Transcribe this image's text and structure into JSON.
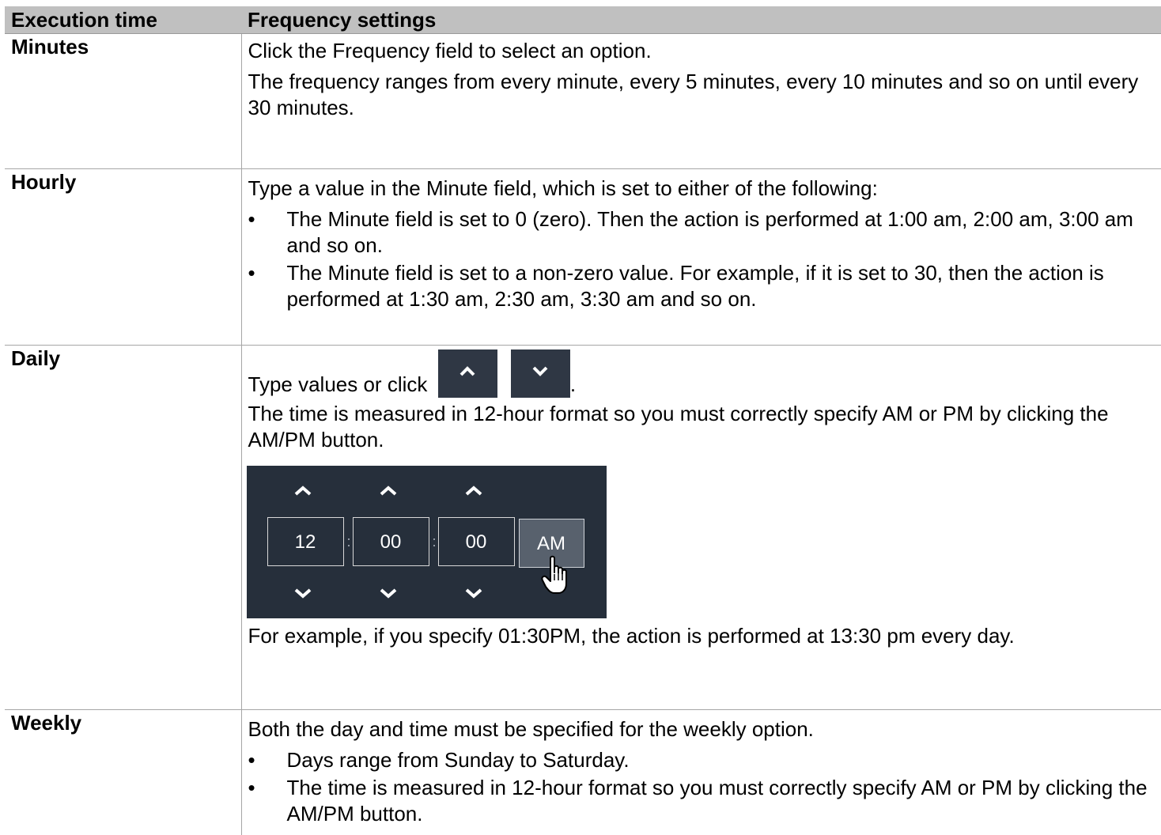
{
  "table": {
    "headers": [
      "Execution time",
      "Frequency settings"
    ],
    "rows": [
      {
        "time": "Minutes",
        "paragraphs": [
          "Click the Frequency field to select an option.",
          "The frequency ranges from every minute, every 5 minutes, every 10 minutes and so on until every 30 minutes."
        ]
      },
      {
        "time": "Hourly",
        "intro": "Type a value in the Minute field, which is set to either of the following:",
        "bullets": [
          "The Minute field is set to 0 (zero). Then the action is performed at 1:00 am, 2:00 am, 3:00 am and so on.",
          "The Minute field is set to a non-zero value. For example, if it is set to 30, then the action is performed at 1:30 am, 2:30 am, 3:30 am and so on."
        ]
      },
      {
        "time": "Daily",
        "type_prefix": "Type values or click",
        "type_suffix": ".",
        "format_note": "The time is measured in 12-hour format so you must correctly specify AM or PM by clicking the AM/PM button.",
        "picker": {
          "hour": "12",
          "minute": "00",
          "second": "00",
          "separator": ":",
          "ampm": "AM"
        },
        "example": "For example, if you specify 01:30PM, the action is performed at 13:30 pm every day."
      },
      {
        "time": "Weekly",
        "intro": "Both the day and time must be specified for the weekly option.",
        "bullets": [
          "Days range from Sunday to Saturday.",
          "The time is measured in 12-hour format so you must correctly specify AM or PM by clicking the AM/PM button."
        ]
      }
    ],
    "bullet_glyph": "•"
  },
  "colors": {
    "header_bg": "#c0c0c0",
    "border": "#a6a6a6",
    "picker_bg": "#262f3b",
    "button_bg": "#2f3744",
    "ampm_bg": "#58616d"
  },
  "icons": {
    "up": "chevron-up-icon",
    "down": "chevron-down-icon",
    "cursor": "hand-pointer-icon"
  }
}
